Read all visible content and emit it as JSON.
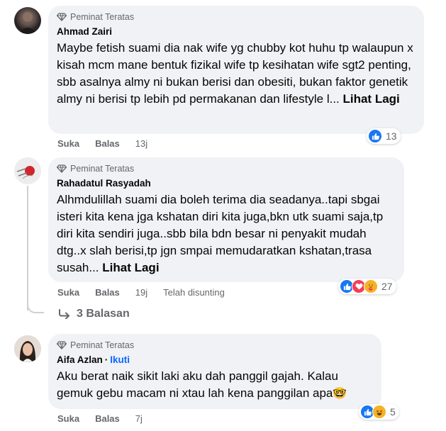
{
  "comments": [
    {
      "badge": "Peminat Teratas",
      "author": "Ahmad Zairi",
      "text": "Maybe fetish suami dia nak wife yg chubby kot huhu tp walaupun x kisah mcm mane bentuk fizikal wife tp kesihatan wife sgt2 penting, sbb asalnya almy ni bukan berisi dan obesiti, bukan faktor genetik almy ni berisi tp lebih pd permakanan dan lifestyle l... ",
      "see_more": "Lihat Lagi",
      "like": "Suka",
      "reply": "Balas",
      "time": "13j",
      "reaction_count": "13",
      "reaction_icons": [
        "like-icon"
      ]
    },
    {
      "badge": "Peminat Teratas",
      "author": "Rahadatul Rasyadah",
      "text": "Alhmdulillah suami dia boleh terima dia seadanya..tapi sbgai isteri kita kena jga kshatan diri kita juga,bkn utk suami saja,tp diri kita sendiri juga..sbb bila bdn besar ni penyakit mudah dtg..x slah berisi,tp jgn smpai memudaratkan kshatan,trasa susah... ",
      "see_more": "Lihat Lagi",
      "like": "Suka",
      "reply": "Balas",
      "time": "19j",
      "edited": "Telah disunting",
      "reaction_count": "27",
      "reaction_icons": [
        "like-icon",
        "love-icon",
        "care-icon"
      ],
      "replies_label": "3 Balasan"
    },
    {
      "badge": "Peminat Teratas",
      "author": "Aifa Azlan",
      "follow": "Ikuti",
      "separator": "·",
      "text": "Aku berat naik sikit laki aku dah panggil gajah. Kalau gemuk gebu macam ni xtau lah kena panggilan apa",
      "text_emoji": "🤓",
      "like": "Suka",
      "reply": "Balas",
      "time": "7j",
      "reaction_count": "5",
      "reaction_icons": [
        "like-icon",
        "haha-icon"
      ]
    }
  ],
  "colors": {
    "bubble": "#f0f2f5",
    "secondary_text": "#65676b",
    "link_blue": "#0866ff",
    "like_blue": "#1877f2",
    "love_red": "#f33e58",
    "care_yellow": "#f7b125"
  }
}
